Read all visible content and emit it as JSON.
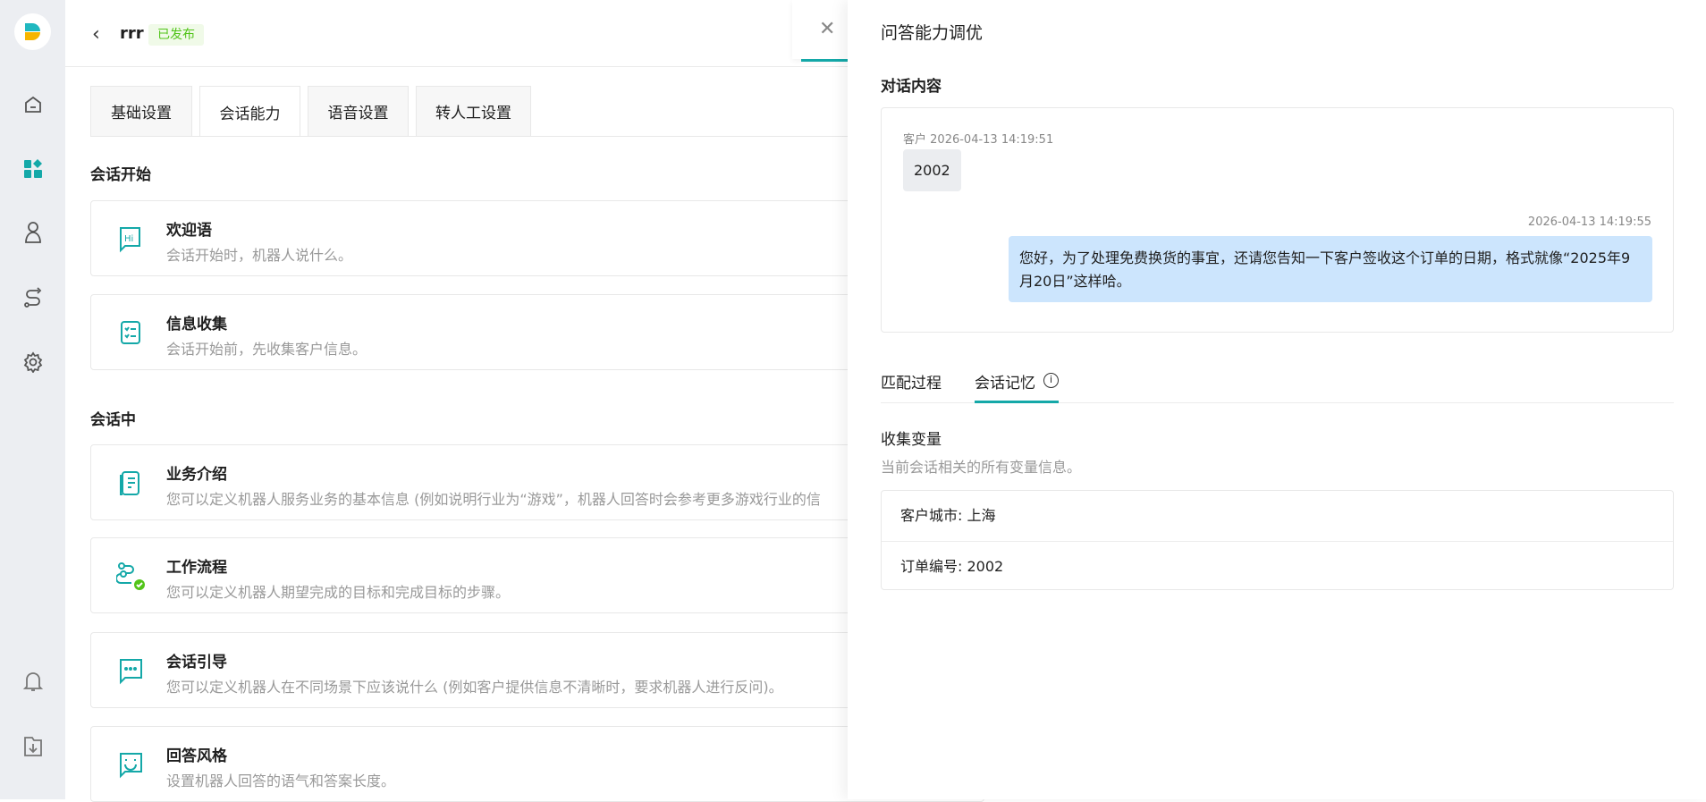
{
  "header": {
    "title": "rrr",
    "status": "已发布",
    "back_label": "返回"
  },
  "tabs": [
    {
      "label": "基础设置"
    },
    {
      "label": "会话能力"
    },
    {
      "label": "语音设置"
    },
    {
      "label": "转人工设置"
    }
  ],
  "sections": [
    {
      "title": "会话开始"
    },
    {
      "title": "会话中"
    }
  ],
  "cards": [
    {
      "title": "欢迎语",
      "desc": "会话开始时，机器人说什么。",
      "icon": "hi-chat-icon"
    },
    {
      "title": "信息收集",
      "desc": "会话开始前，先收集客户信息。",
      "icon": "checklist-icon"
    },
    {
      "title": "业务介绍",
      "desc": "您可以定义机器人服务业务的基本信息 (例如说明行业为“游戏”，机器人回答时会参考更多游戏行业的信",
      "icon": "document-icon"
    },
    {
      "title": "工作流程",
      "desc": "您可以定义机器人期望完成的目标和完成目标的步骤。",
      "icon": "workflow-icon"
    },
    {
      "title": "会话引导",
      "desc": "您可以定义机器人在不同场景下应该说什么 (例如客户提供信息不清晰时，要求机器人进行反问)。",
      "icon": "chat-dots-icon"
    },
    {
      "title": "回答风格",
      "desc": "设置机器人回答的语气和答案长度。",
      "icon": "smile-chat-icon"
    }
  ],
  "drawer": {
    "title": "问答能力调优",
    "conversation_title": "对话内容",
    "messages": [
      {
        "sender": "客户",
        "time": "2026-04-13 14:19:51",
        "text": "2002"
      },
      {
        "time": "2026-04-13 14:19:55",
        "text": "您好，为了处理免费换货的事宜，还请您告知一下客户签收这个订单的日期，格式就像“2025年9月20日”这样哈。"
      }
    ],
    "tabs": [
      {
        "label": "匹配过程"
      },
      {
        "label": "会话记忆"
      }
    ],
    "variables_title": "收集变量",
    "variables_desc": "当前会话相关的所有变量信息。",
    "variables": [
      {
        "text": "客户城市: 上海"
      },
      {
        "text": "订单编号: 2002"
      }
    ]
  },
  "colors": {
    "accent": "#14a8a8",
    "badge_green": "#52c41a",
    "bubble_blue": "#cce5fd"
  }
}
